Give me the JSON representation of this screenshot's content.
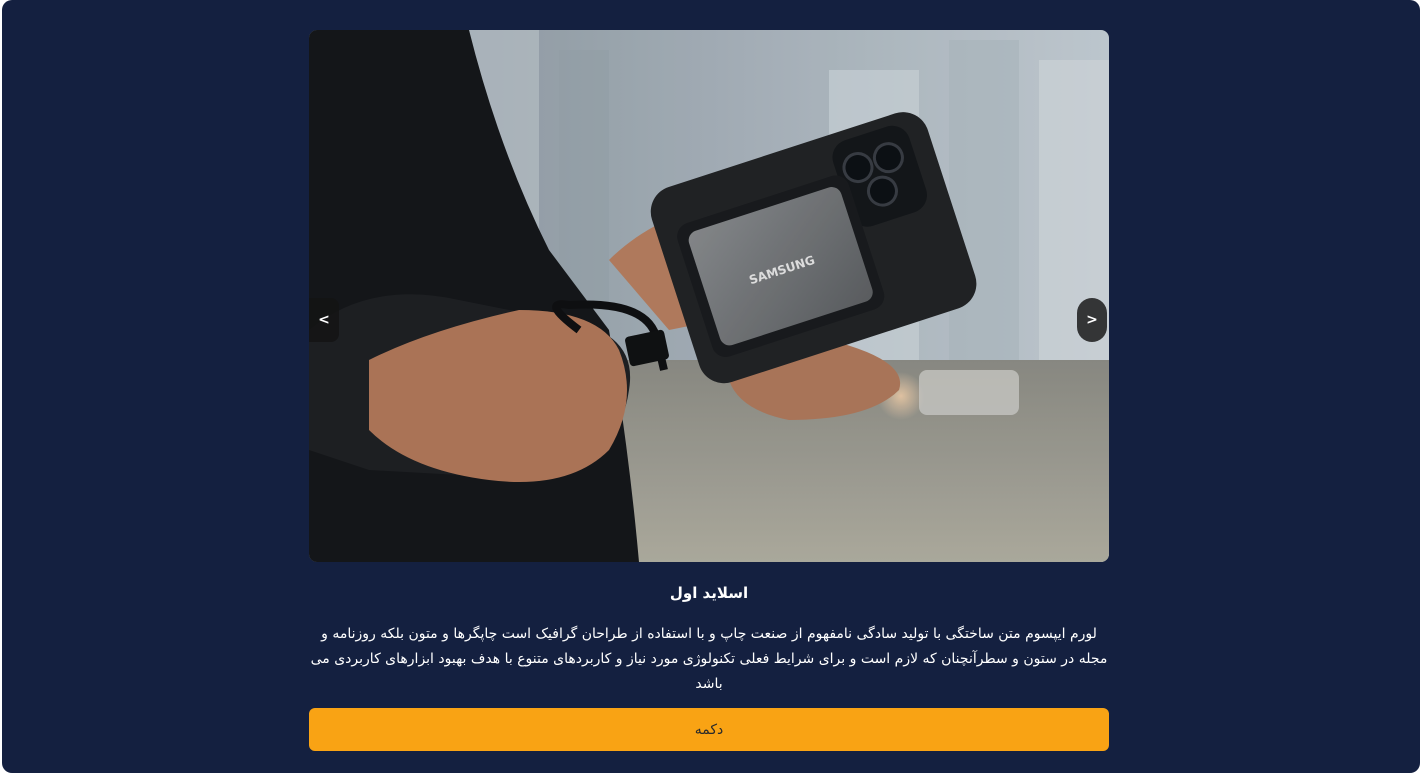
{
  "slide": {
    "title": "اسلاید اول",
    "description": "لورم ایپسوم متن ساختگی با تولید سادگی نامفهوم از صنعت چاپ و با استفاده از طراحان گرافیک است چاپگرها و متون بلکه روزنامه و مجله در ستون و سطرآنچنان که لازم است و برای شرایط فعلی تکنولوژی مورد نیاز و کاربردهای متنوع با هدف بهبود ابزارهای کاربردی می باشد",
    "image_brand_text": "SAMSUNG",
    "button_label": "دکمه"
  },
  "nav": {
    "prev_icon": "<",
    "next_icon": ">"
  },
  "colors": {
    "background": "#142040",
    "button": "#f9a314"
  }
}
